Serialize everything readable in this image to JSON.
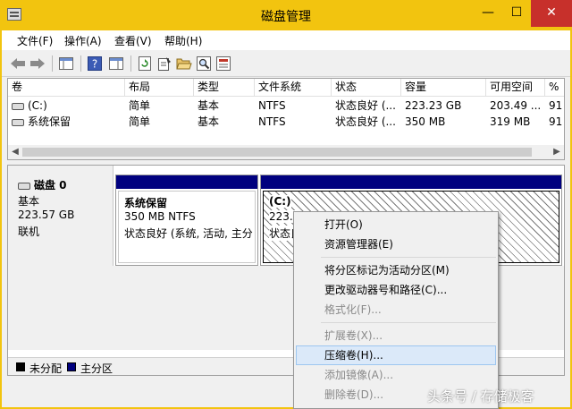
{
  "window": {
    "title": "磁盘管理",
    "minimize_glyph": "—",
    "maximize_glyph": "☐",
    "close_glyph": "✕"
  },
  "menu": [
    "文件(F)",
    "操作(A)",
    "查看(V)",
    "帮助(H)"
  ],
  "toolbar_icons": [
    "back-arrow-icon",
    "forward-arrow-icon",
    "console-tree-icon",
    "help-icon",
    "show-hide-icon",
    "refresh-icon",
    "properties-icon",
    "open-folder-icon",
    "magnifier-icon",
    "export-icon"
  ],
  "volume_list": {
    "columns": [
      "卷",
      "布局",
      "类型",
      "文件系统",
      "状态",
      "容量",
      "可用空间",
      "%"
    ],
    "rows": [
      [
        "(C:)",
        "简单",
        "基本",
        "NTFS",
        "状态良好 (...",
        "223.23 GB",
        "203.49 ...",
        "91"
      ],
      [
        "系统保留",
        "简单",
        "基本",
        "NTFS",
        "状态良好 (...",
        "350 MB",
        "319 MB",
        "91"
      ]
    ]
  },
  "disk": {
    "name": "磁盘 0",
    "type": "基本",
    "size": "223.57 GB",
    "status": "联机",
    "partitions": [
      {
        "name": "系统保留",
        "size_fs": "350 MB NTFS",
        "status": "状态良好 (系统, 活动, 主分"
      },
      {
        "name": "(C:)",
        "size_fs": "223.2",
        "status": "状态良"
      }
    ]
  },
  "legend": [
    {
      "label": "未分配",
      "color": "#000000"
    },
    {
      "label": "主分区",
      "color": "#00007f"
    }
  ],
  "context_menu": {
    "items": [
      {
        "label": "打开(O)",
        "enabled": true
      },
      {
        "label": "资源管理器(E)",
        "enabled": true
      },
      {
        "label": "将分区标记为活动分区(M)",
        "enabled": true
      },
      {
        "label": "更改驱动器号和路径(C)...",
        "enabled": true
      },
      {
        "label": "格式化(F)...",
        "enabled": false
      },
      {
        "label": "扩展卷(X)...",
        "enabled": false
      },
      {
        "label": "压缩卷(H)...",
        "enabled": true,
        "highlighted": true
      },
      {
        "label": "添加镜像(A)...",
        "enabled": false
      },
      {
        "label": "删除卷(D)...",
        "enabled": false
      }
    ]
  },
  "watermark": "头条号 / 存储极客"
}
